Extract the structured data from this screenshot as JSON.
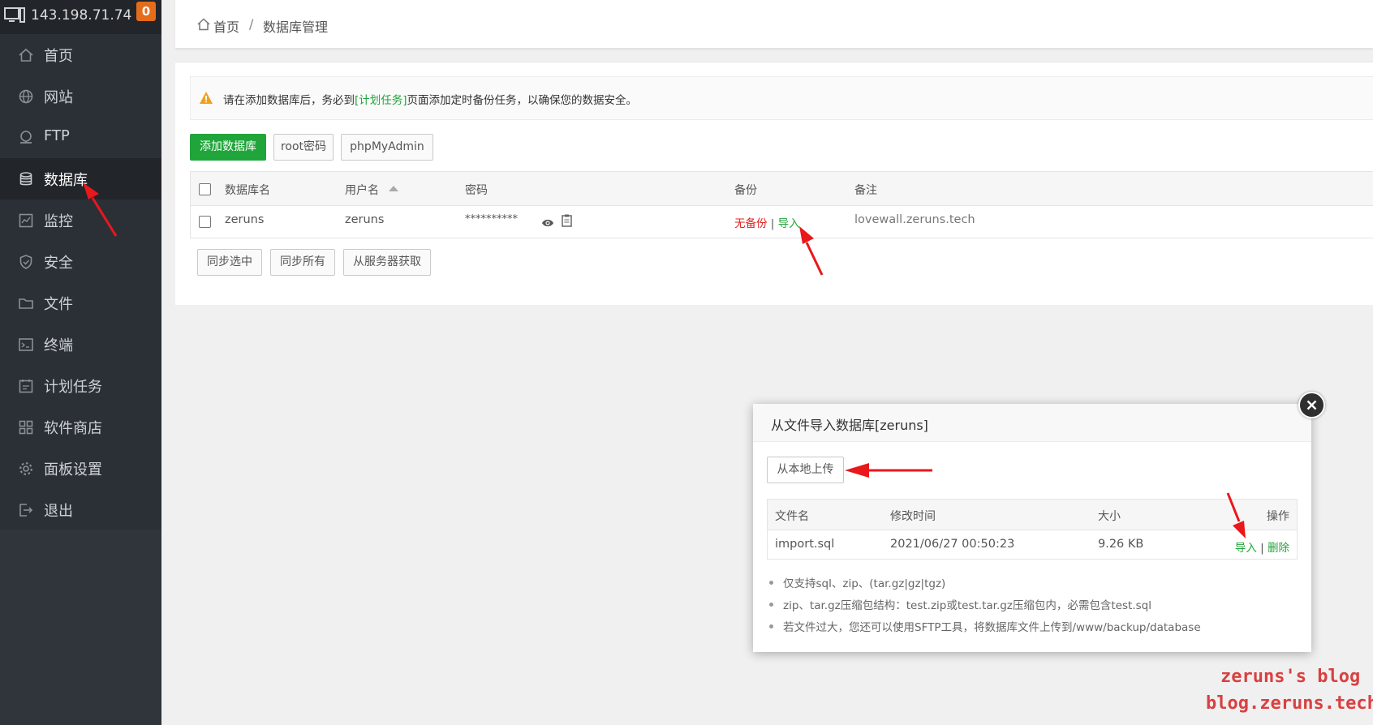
{
  "sidebar": {
    "server_ip": "143.198.71.74",
    "badge_count": "0",
    "items": [
      {
        "label": "首页",
        "icon": "home-icon"
      },
      {
        "label": "网站",
        "icon": "globe-icon"
      },
      {
        "label": "FTP",
        "icon": "ftp-icon"
      },
      {
        "label": "数据库",
        "icon": "database-icon",
        "active": true
      },
      {
        "label": "监控",
        "icon": "monitor-chart-icon"
      },
      {
        "label": "安全",
        "icon": "shield-icon"
      },
      {
        "label": "文件",
        "icon": "folder-icon"
      },
      {
        "label": "终端",
        "icon": "terminal-icon"
      },
      {
        "label": "计划任务",
        "icon": "calendar-icon"
      },
      {
        "label": "软件商店",
        "icon": "grid-icon"
      },
      {
        "label": "面板设置",
        "icon": "gear-icon"
      },
      {
        "label": "退出",
        "icon": "logout-icon"
      }
    ]
  },
  "breadcrumb": {
    "home": "首页",
    "separator": "/",
    "current": "数据库管理"
  },
  "notice": {
    "prefix": "请在添加数据库后，务必到",
    "link": "[计划任务]",
    "suffix": "页面添加定时备份任务，以确保您的数据安全。"
  },
  "toolbar": {
    "add_db": "添加数据库",
    "root_pwd": "root密码",
    "phpmyadmin": "phpMyAdmin"
  },
  "db_table": {
    "headers": {
      "name": "数据库名",
      "user": "用户名",
      "password": "密码",
      "backup": "备份",
      "remark": "备注"
    },
    "rows": [
      {
        "name": "zeruns",
        "user": "zeruns",
        "password": "**********",
        "backup_status": "无备份",
        "backup_sep": "|",
        "import": "导入",
        "remark": "lovewall.zeruns.tech"
      }
    ]
  },
  "bottom_buttons": {
    "sync_selected": "同步选中",
    "sync_all": "同步所有",
    "fetch_server": "从服务器获取"
  },
  "modal": {
    "title": "从文件导入数据库[zeruns]",
    "upload_btn": "从本地上传",
    "headers": {
      "file": "文件名",
      "mtime": "修改时间",
      "size": "大小",
      "ops": "操作"
    },
    "files": [
      {
        "name": "import.sql",
        "mtime": "2021/06/27 00:50:23",
        "size": "9.26 KB",
        "import": "导入",
        "sep": "|",
        "delete": "删除"
      }
    ],
    "tips": [
      "仅支持sql、zip、(tar.gz|gz|tgz)",
      "zip、tar.gz压缩包结构：test.zip或test.tar.gz压缩包内，必需包含test.sql",
      "若文件过大，您还可以使用SFTP工具，将数据库文件上传到/www/backup/database"
    ]
  },
  "watermark": {
    "line1": "zeruns's blog",
    "line2": "blog.zeruns.tech"
  },
  "colors": {
    "accent_green": "#20a53a",
    "danger_red": "#e02020",
    "sidebar_bg": "#2b3036",
    "badge_orange": "#e46c1a"
  }
}
